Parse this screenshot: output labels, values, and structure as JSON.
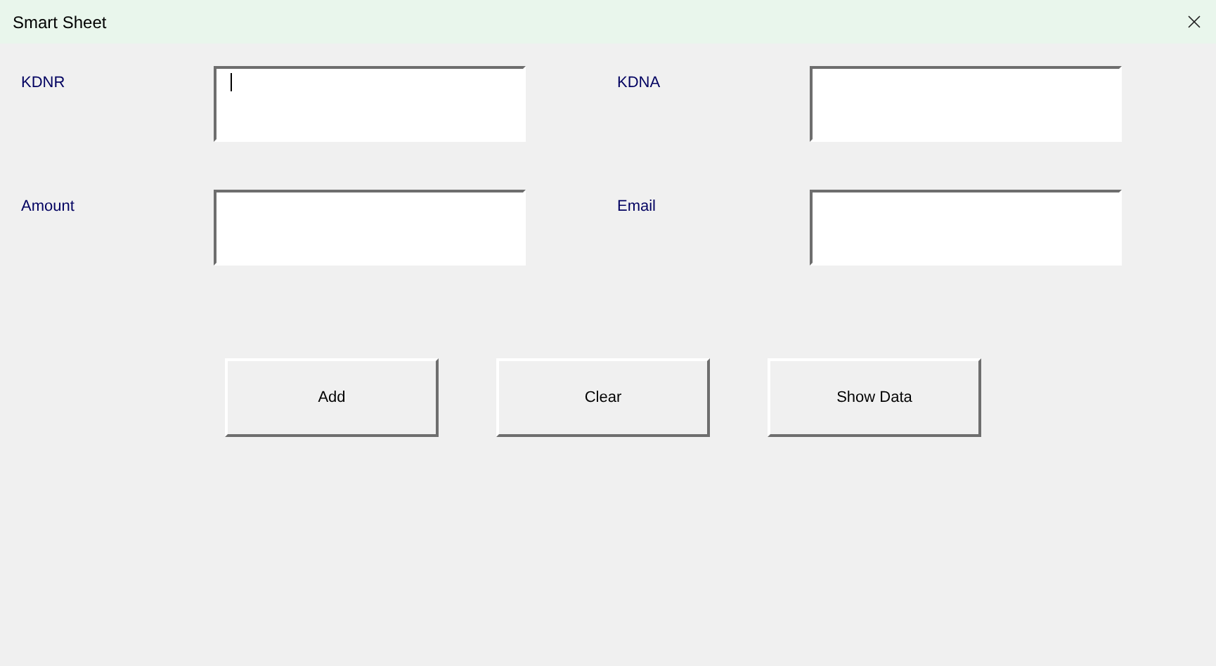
{
  "window": {
    "title": "Smart Sheet"
  },
  "fields": [
    {
      "label": "KDNR",
      "focused": true
    },
    {
      "label": "KDNA",
      "focused": false
    },
    {
      "label": "Amount",
      "focused": false
    },
    {
      "label": "Email",
      "focused": false
    }
  ],
  "buttons": [
    "Add",
    "Clear",
    "Show Data"
  ]
}
